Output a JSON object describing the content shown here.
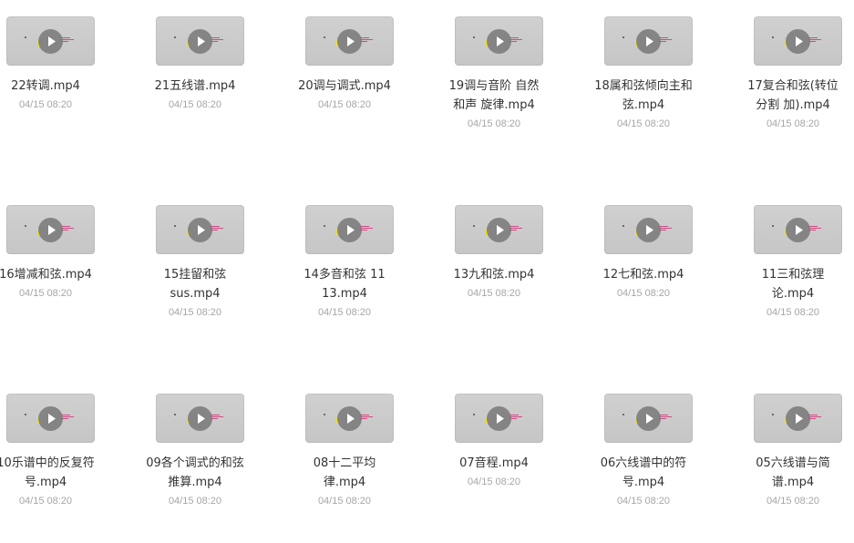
{
  "files": [
    {
      "name_lines": [
        "22转调.mp4"
      ],
      "date": "04/15 08:20"
    },
    {
      "name_lines": [
        "21五线谱.mp4"
      ],
      "date": "04/15 08:20"
    },
    {
      "name_lines": [
        "20调与调式.mp4"
      ],
      "date": "04/15 08:20"
    },
    {
      "name_lines": [
        "19调与音阶 自然",
        "和声 旋律.mp4"
      ],
      "date": "04/15 08:20"
    },
    {
      "name_lines": [
        "18属和弦倾向主和",
        "弦.mp4"
      ],
      "date": "04/15 08:20"
    },
    {
      "name_lines": [
        "17复合和弦(转位",
        "分割 加).mp4"
      ],
      "date": "04/15 08:20"
    },
    {
      "name_lines": [
        "16增减和弦.mp4"
      ],
      "date": "04/15 08:20"
    },
    {
      "name_lines": [
        "15挂留和弦",
        "sus.mp4"
      ],
      "date": "04/15 08:20"
    },
    {
      "name_lines": [
        "14多音和弦 11",
        "13.mp4"
      ],
      "date": "04/15 08:20"
    },
    {
      "name_lines": [
        "13九和弦.mp4"
      ],
      "date": "04/15 08:20"
    },
    {
      "name_lines": [
        "12七和弦.mp4"
      ],
      "date": "04/15 08:20"
    },
    {
      "name_lines": [
        "11三和弦理",
        "论.mp4"
      ],
      "date": "04/15 08:20"
    },
    {
      "name_lines": [
        "10乐谱中的反复符",
        "号.mp4"
      ],
      "date": "04/15 08:20"
    },
    {
      "name_lines": [
        "09各个调式的和弦",
        "推算.mp4"
      ],
      "date": "04/15 08:20"
    },
    {
      "name_lines": [
        "08十二平均",
        "律.mp4"
      ],
      "date": "04/15 08:20"
    },
    {
      "name_lines": [
        "07音程.mp4"
      ],
      "date": "04/15 08:20"
    },
    {
      "name_lines": [
        "06六线谱中的符",
        "号.mp4"
      ],
      "date": "04/15 08:20"
    },
    {
      "name_lines": [
        "05六线谱与简",
        "谱.mp4"
      ],
      "date": "04/15 08:20"
    }
  ],
  "icons": {
    "thumbnail": "video-thumbnail-icon",
    "play": "play-icon"
  },
  "colors": {
    "name_text": "#333333",
    "date_text": "#a6a6a6",
    "thumbnail_bg": "#c9c9c9"
  }
}
